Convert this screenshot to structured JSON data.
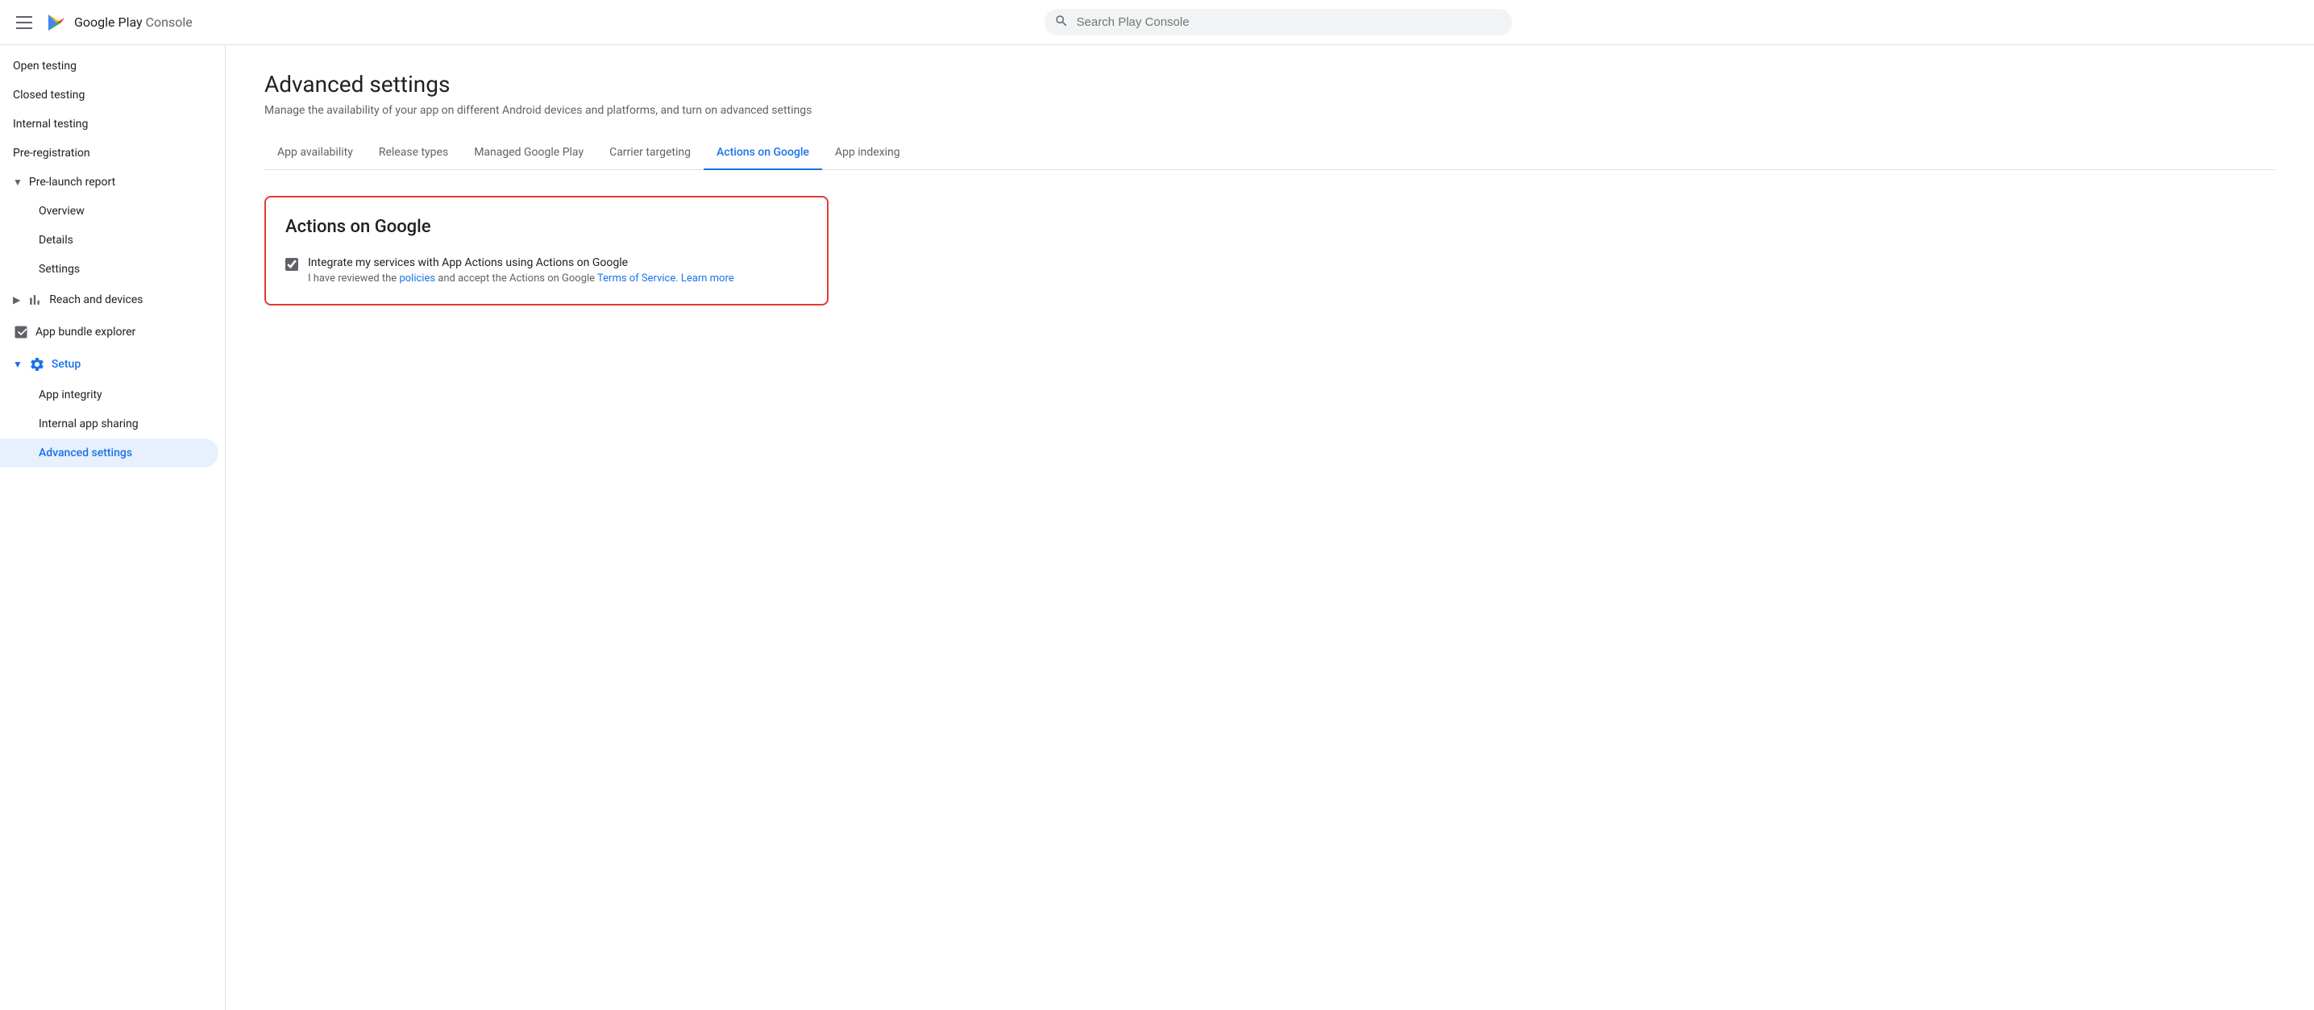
{
  "topbar": {
    "logo_text_play": "Google Play",
    "logo_text_console": "Console",
    "search_placeholder": "Search Play Console"
  },
  "sidebar": {
    "items": [
      {
        "id": "open-testing",
        "label": "Open testing",
        "indent": false,
        "active": false
      },
      {
        "id": "closed-testing",
        "label": "Closed testing",
        "indent": false,
        "active": false
      },
      {
        "id": "internal-testing",
        "label": "Internal testing",
        "indent": false,
        "active": false
      },
      {
        "id": "pre-registration",
        "label": "Pre-registration",
        "indent": false,
        "active": false
      },
      {
        "id": "pre-launch-report",
        "label": "Pre-launch report",
        "indent": false,
        "active": false,
        "expandable": true,
        "expanded": true
      },
      {
        "id": "overview",
        "label": "Overview",
        "indent": true,
        "active": false
      },
      {
        "id": "details",
        "label": "Details",
        "indent": true,
        "active": false
      },
      {
        "id": "settings",
        "label": "Settings",
        "indent": true,
        "active": false
      },
      {
        "id": "reach-and-devices",
        "label": "Reach and devices",
        "indent": false,
        "active": false,
        "expandable": true,
        "hasIcon": "chart"
      },
      {
        "id": "app-bundle-explorer",
        "label": "App bundle explorer",
        "indent": false,
        "active": false,
        "hasIcon": "bundle"
      },
      {
        "id": "setup",
        "label": "Setup",
        "indent": false,
        "active": false,
        "expandable": true,
        "expanded": true,
        "hasIcon": "gear",
        "activeSection": true
      },
      {
        "id": "app-integrity",
        "label": "App integrity",
        "indent": true,
        "active": false
      },
      {
        "id": "internal-app-sharing",
        "label": "Internal app sharing",
        "indent": true,
        "active": false
      },
      {
        "id": "advanced-settings",
        "label": "Advanced settings",
        "indent": true,
        "active": true
      }
    ]
  },
  "page": {
    "title": "Advanced settings",
    "subtitle": "Manage the availability of your app on different Android devices and platforms, and turn on advanced settings"
  },
  "tabs": [
    {
      "id": "app-availability",
      "label": "App availability",
      "active": false
    },
    {
      "id": "release-types",
      "label": "Release types",
      "active": false
    },
    {
      "id": "managed-google-play",
      "label": "Managed Google Play",
      "active": false
    },
    {
      "id": "carrier-targeting",
      "label": "Carrier targeting",
      "active": false
    },
    {
      "id": "actions-on-google",
      "label": "Actions on Google",
      "active": true
    },
    {
      "id": "app-indexing",
      "label": "App indexing",
      "active": false
    }
  ],
  "card": {
    "title": "Actions on Google",
    "checkbox_label": "Integrate my services with App Actions using Actions on Google",
    "checkbox_sublabel_pre": "I have reviewed the ",
    "checkbox_sublabel_policies": "policies",
    "checkbox_sublabel_mid": " and accept the Actions on Google ",
    "checkbox_sublabel_tos": "Terms of Service.",
    "checkbox_sublabel_learn": " Learn more",
    "checkbox_checked": true
  }
}
